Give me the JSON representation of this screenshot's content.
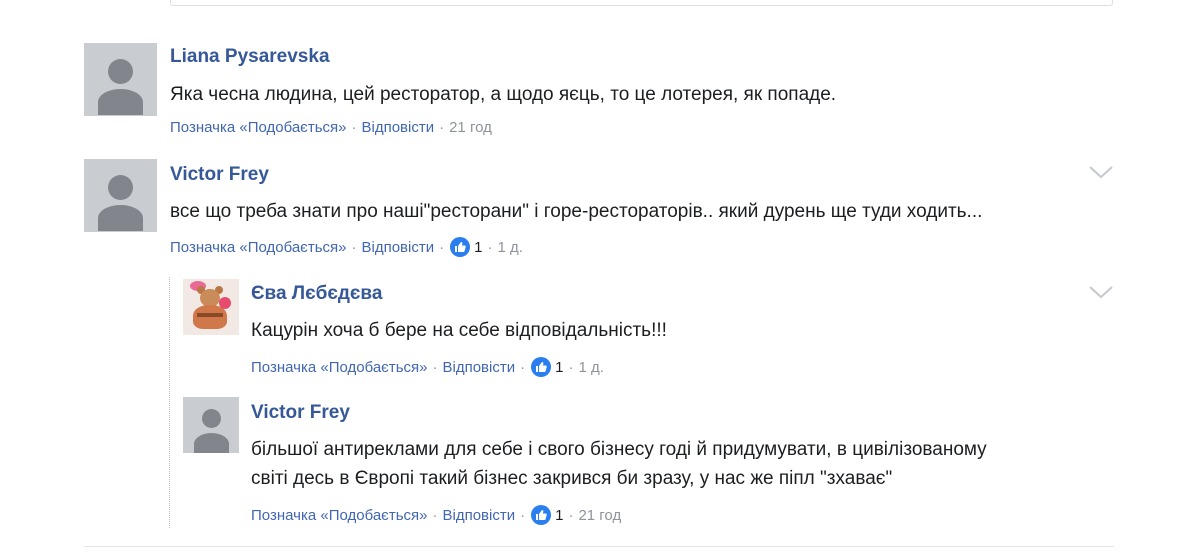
{
  "comments": [
    {
      "author": "Liana Pysarevska",
      "text": "Яка чесна людина, цей ресторатор, а щодо яєць, то це лотерея, як попаде.",
      "like_label": "Позначка «Подобається»",
      "reply_label": "Відповісти",
      "time": "21 год"
    },
    {
      "author": "Victor Frey",
      "text": "все що треба знати про наші\"ресторани\" і горе-рестораторів.. який дурень ще туди ходить...",
      "like_label": "Позначка «Подобається»",
      "reply_label": "Відповісти",
      "reactions": "1",
      "time": "1 д.",
      "replies": [
        {
          "author": "Єва Лєбєдєва",
          "text": "Кацурін хоча б бере на себе відповідальність!!!",
          "like_label": "Позначка «Подобається»",
          "reply_label": "Відповісти",
          "reactions": "1",
          "time": "1 д."
        },
        {
          "author": "Victor Frey",
          "text_line1": "більшої антиреклами для себе і свого бізнесу годі й придумувати, в цивілізованому",
          "text_line2": "світі десь в Європі такий бізнес закрився би зразу, у нас же піпл \"зхаває\"",
          "like_label": "Позначка «Подобається»",
          "reply_label": "Відповісти",
          "reactions": "1",
          "time": "21 год"
        }
      ]
    }
  ],
  "separator": "·",
  "colors": {
    "link": "#4267b2",
    "author": "#365899",
    "meta": "#90949c",
    "like_badge": "#2a7ef0"
  },
  "icons": {
    "avatar_default": "default-avatar-icon",
    "like": "thumbs-up-icon",
    "menu": "chevron-down-icon"
  }
}
